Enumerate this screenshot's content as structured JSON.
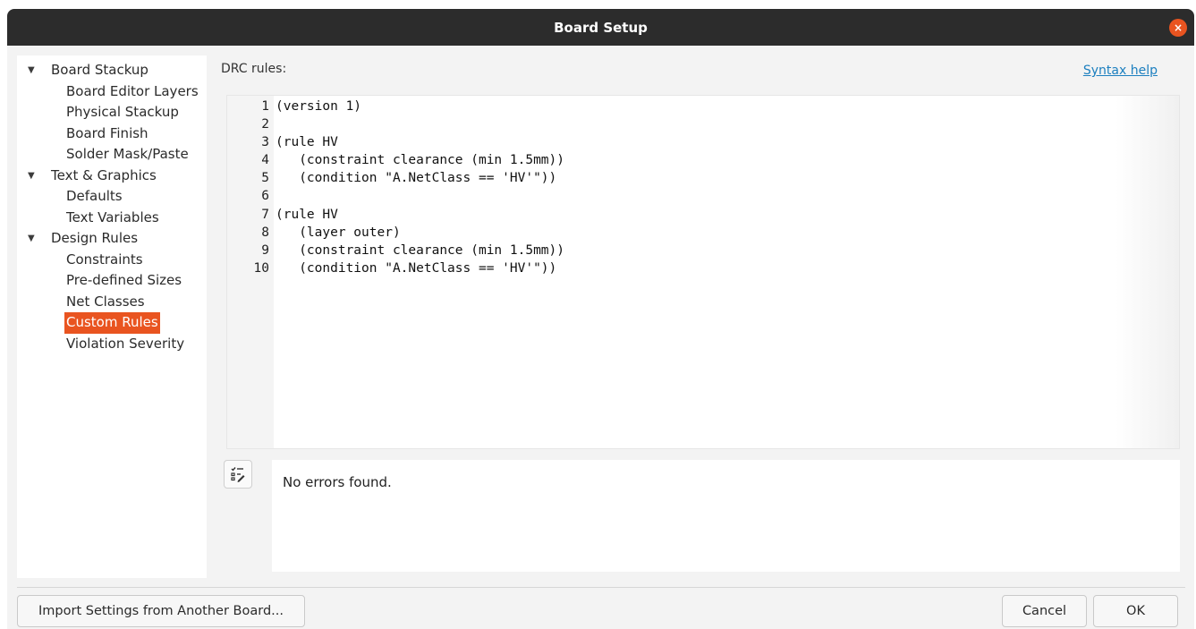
{
  "window": {
    "title": "Board Setup",
    "close_icon": "×"
  },
  "tree": [
    {
      "label": "Board Stackup",
      "level": 0,
      "expanded": true
    },
    {
      "label": "Board Editor Layers",
      "level": 1
    },
    {
      "label": "Physical Stackup",
      "level": 1
    },
    {
      "label": "Board Finish",
      "level": 1
    },
    {
      "label": "Solder Mask/Paste",
      "level": 1
    },
    {
      "label": "Text & Graphics",
      "level": 0,
      "expanded": true
    },
    {
      "label": "Defaults",
      "level": 1
    },
    {
      "label": "Text Variables",
      "level": 1
    },
    {
      "label": "Design Rules",
      "level": 0,
      "expanded": true
    },
    {
      "label": "Constraints",
      "level": 1
    },
    {
      "label": "Pre-defined Sizes",
      "level": 1
    },
    {
      "label": "Net Classes",
      "level": 1
    },
    {
      "label": "Custom Rules",
      "level": 1,
      "selected": true
    },
    {
      "label": "Violation Severity",
      "level": 1
    }
  ],
  "tree_arrow_glyph": "▼",
  "main": {
    "drc_label": "DRC rules:",
    "syntax_help": "Syntax help",
    "code_lines": [
      {
        "n": "1",
        "text": "(version 1)"
      },
      {
        "n": "2",
        "text": ""
      },
      {
        "n": "3",
        "text": "(rule HV"
      },
      {
        "n": "4",
        "text": "   (constraint clearance (min 1.5mm))"
      },
      {
        "n": "5",
        "text": "   (condition \"A.NetClass == 'HV'\"))"
      },
      {
        "n": "6",
        "text": ""
      },
      {
        "n": "7",
        "text": "(rule HV"
      },
      {
        "n": "8",
        "text": "   (layer outer)"
      },
      {
        "n": "9",
        "text": "   (constraint clearance (min 1.5mm))"
      },
      {
        "n": "10",
        "text": "   (condition \"A.NetClass == 'HV'\"))"
      }
    ],
    "check_button_icon": "check-rules-icon",
    "message": "No errors found."
  },
  "buttons": {
    "import": "Import Settings from Another Board...",
    "cancel": "Cancel",
    "ok": "OK"
  },
  "colors": {
    "accent": "#e95420",
    "link": "#1c7fbf",
    "titlebar": "#2c2c2c"
  }
}
